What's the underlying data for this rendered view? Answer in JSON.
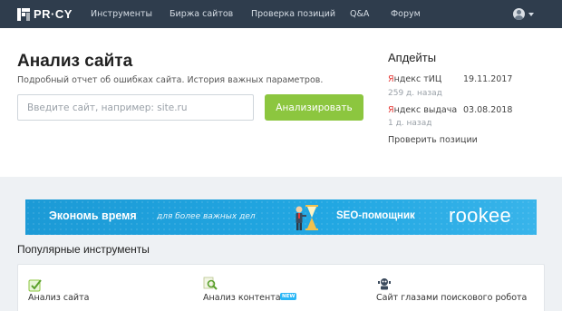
{
  "topbar": {
    "logo": "PR·CY",
    "nav": [
      "Инструменты",
      "Биржа сайтов",
      "Проверка позиций",
      "Q&A",
      "Форум"
    ]
  },
  "hero": {
    "title": "Анализ сайта",
    "subtitle": "Подробный отчет об ошибках сайта. История важных параметров.",
    "input_placeholder": "Введите сайт, например: site.ru",
    "input_value": "",
    "button_label": "Анализировать"
  },
  "updates": {
    "title": "Апдейты",
    "items": [
      {
        "brand": "Я",
        "name": "ндекс тИЦ",
        "date": "19.11.2017",
        "ago": "259 д. назад"
      },
      {
        "brand": "Я",
        "name": "ндекс выдача",
        "date": "03.08.2018",
        "ago": "1 д. назад"
      }
    ],
    "check_link": "Проверить позиции"
  },
  "banner": {
    "main": "Экономь время",
    "sub": "для более важных дел",
    "seo": "SEO-помощник",
    "brand": "rookee"
  },
  "popular": {
    "title": "Популярные инструменты",
    "tools": [
      {
        "label": "Анализ сайта",
        "icon": "check-icon",
        "badge": ""
      },
      {
        "label": "Анализ контента",
        "icon": "magnifier-icon",
        "badge": "NEW"
      },
      {
        "label": "Сайт глазами поискового робота",
        "icon": "robot-icon",
        "badge": ""
      }
    ]
  },
  "colors": {
    "topbar": "#2f3d4d",
    "accent_green": "#8cc63f",
    "yandex_red": "#e53935",
    "banner_blue": "#22a7e2"
  }
}
